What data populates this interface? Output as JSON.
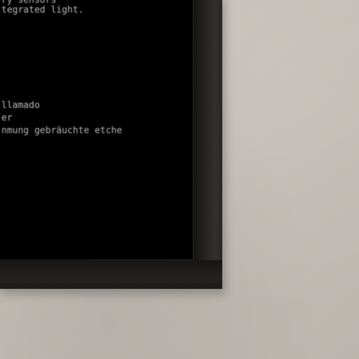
{
  "scene": {
    "description_colors": {
      "wall": "#c6c0ba",
      "frame": "#23201e",
      "screen": "#000000",
      "text": "#d8d8d2"
    }
  },
  "screen_text": {
    "lines": [
      "ry sensors",
      "tegrated light.",
      "",
      "llamado",
      "er",
      "nmung gebräuchte etche"
    ]
  }
}
